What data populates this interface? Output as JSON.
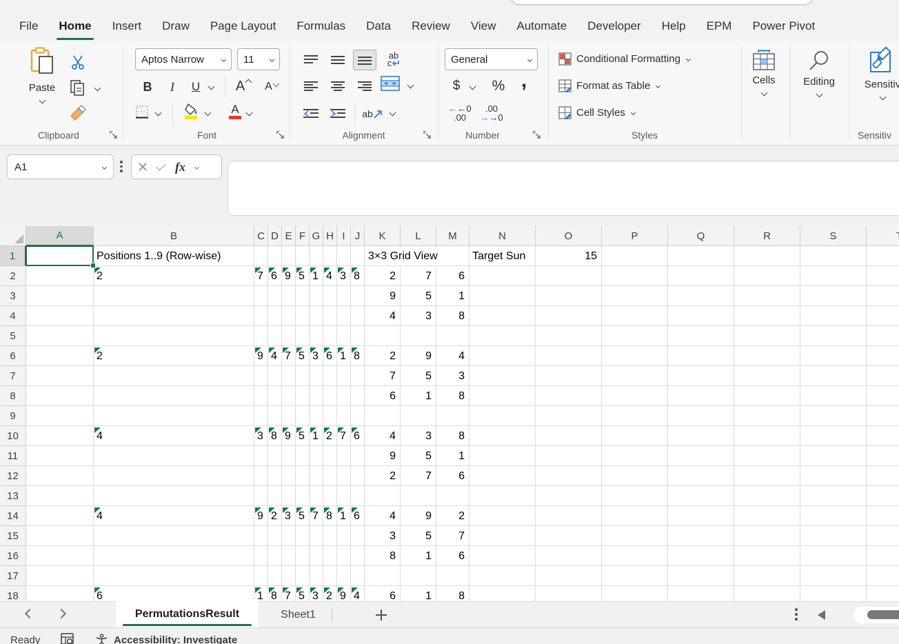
{
  "titlebar": {
    "menu": [
      "File",
      "Home",
      "Insert",
      "Draw",
      "Page Layout",
      "Formulas",
      "Data",
      "Review",
      "View",
      "Automate",
      "Developer",
      "Help",
      "EPM",
      "Power Pivot"
    ],
    "active_tab": "Home"
  },
  "colors": {
    "excel_green": "#217346",
    "selection_green": "#1E7145",
    "error_triangle_green": "#107C41",
    "accent_blue": "#2B7CD3",
    "fill_yellow": "#FFE400",
    "font_red": "#E03C31"
  },
  "ribbon": {
    "clipboard": {
      "group_label": "Clipboard",
      "paste_label": "Paste"
    },
    "font": {
      "group_label": "Font",
      "font_name": "Aptos Narrow",
      "font_size": "11",
      "bold": "B",
      "italic": "I",
      "underline": "U",
      "grow": "A",
      "shrink": "A"
    },
    "alignment": {
      "group_label": "Alignment",
      "wrap_top": "ab",
      "wrap_bottom": "c",
      "orient": "ab"
    },
    "number": {
      "group_label": "Number",
      "format": "General",
      "currency": "$",
      "percent": "%",
      "comma": ",",
      "inc_top": "←0",
      "inc_bot": ".00",
      "dec_top": ".00",
      "dec_bot": "→0"
    },
    "styles": {
      "group_label": "Styles",
      "items": [
        "Conditional Formatting",
        "Format as Table",
        "Cell Styles"
      ]
    },
    "cells": {
      "label": "Cells"
    },
    "editing": {
      "label": "Editing"
    },
    "sensitivity": {
      "label": "Sensitiv",
      "group_label": "Sensitiv"
    }
  },
  "formula_bar": {
    "name_box": "A1",
    "fx": "fx",
    "formula": ""
  },
  "grid": {
    "selected_cell": "A1",
    "columns": [
      "A",
      "B",
      "C",
      "D",
      "E",
      "F",
      "G",
      "H",
      "I",
      "J",
      "K",
      "L",
      "M",
      "N",
      "O",
      "P",
      "Q",
      "R",
      "S",
      "T"
    ],
    "row_numbers": [
      1,
      2,
      3,
      4,
      5,
      6,
      7,
      8,
      9,
      10,
      11,
      12,
      13,
      14,
      15,
      16,
      17,
      18
    ],
    "cells": [
      {
        "r": 1,
        "c": "B",
        "v": "Positions 1..9 (Row-wise)"
      },
      {
        "r": 1,
        "c": "K",
        "v": "3×3 Grid View",
        "span": 3
      },
      {
        "r": 1,
        "c": "N",
        "v": "Target Sun",
        "clip": true
      },
      {
        "r": 1,
        "c": "O",
        "v": "15",
        "a": "r"
      },
      {
        "r": 2,
        "c": "B",
        "v": "2",
        "t": 1
      },
      {
        "r": 2,
        "c": "C",
        "v": "7",
        "t": 1
      },
      {
        "r": 2,
        "c": "D",
        "v": "6",
        "t": 1
      },
      {
        "r": 2,
        "c": "E",
        "v": "9",
        "t": 1
      },
      {
        "r": 2,
        "c": "F",
        "v": "5",
        "t": 1
      },
      {
        "r": 2,
        "c": "G",
        "v": "1",
        "t": 1
      },
      {
        "r": 2,
        "c": "H",
        "v": "4",
        "t": 1
      },
      {
        "r": 2,
        "c": "I",
        "v": "3",
        "t": 1
      },
      {
        "r": 2,
        "c": "J",
        "v": "8",
        "t": 1
      },
      {
        "r": 2,
        "c": "K",
        "v": "2",
        "a": "r"
      },
      {
        "r": 2,
        "c": "L",
        "v": "7",
        "a": "r"
      },
      {
        "r": 2,
        "c": "M",
        "v": "6",
        "a": "r"
      },
      {
        "r": 3,
        "c": "K",
        "v": "9",
        "a": "r"
      },
      {
        "r": 3,
        "c": "L",
        "v": "5",
        "a": "r"
      },
      {
        "r": 3,
        "c": "M",
        "v": "1",
        "a": "r"
      },
      {
        "r": 4,
        "c": "K",
        "v": "4",
        "a": "r"
      },
      {
        "r": 4,
        "c": "L",
        "v": "3",
        "a": "r"
      },
      {
        "r": 4,
        "c": "M",
        "v": "8",
        "a": "r"
      },
      {
        "r": 6,
        "c": "B",
        "v": "2",
        "t": 1
      },
      {
        "r": 6,
        "c": "C",
        "v": "9",
        "t": 1
      },
      {
        "r": 6,
        "c": "D",
        "v": "4",
        "t": 1
      },
      {
        "r": 6,
        "c": "E",
        "v": "7",
        "t": 1
      },
      {
        "r": 6,
        "c": "F",
        "v": "5",
        "t": 1
      },
      {
        "r": 6,
        "c": "G",
        "v": "3",
        "t": 1
      },
      {
        "r": 6,
        "c": "H",
        "v": "6",
        "t": 1
      },
      {
        "r": 6,
        "c": "I",
        "v": "1",
        "t": 1
      },
      {
        "r": 6,
        "c": "J",
        "v": "8",
        "t": 1
      },
      {
        "r": 6,
        "c": "K",
        "v": "2",
        "a": "r"
      },
      {
        "r": 6,
        "c": "L",
        "v": "9",
        "a": "r"
      },
      {
        "r": 6,
        "c": "M",
        "v": "4",
        "a": "r"
      },
      {
        "r": 7,
        "c": "K",
        "v": "7",
        "a": "r"
      },
      {
        "r": 7,
        "c": "L",
        "v": "5",
        "a": "r"
      },
      {
        "r": 7,
        "c": "M",
        "v": "3",
        "a": "r"
      },
      {
        "r": 8,
        "c": "K",
        "v": "6",
        "a": "r"
      },
      {
        "r": 8,
        "c": "L",
        "v": "1",
        "a": "r"
      },
      {
        "r": 8,
        "c": "M",
        "v": "8",
        "a": "r"
      },
      {
        "r": 10,
        "c": "B",
        "v": "4",
        "t": 1
      },
      {
        "r": 10,
        "c": "C",
        "v": "3",
        "t": 1
      },
      {
        "r": 10,
        "c": "D",
        "v": "8",
        "t": 1
      },
      {
        "r": 10,
        "c": "E",
        "v": "9",
        "t": 1
      },
      {
        "r": 10,
        "c": "F",
        "v": "5",
        "t": 1
      },
      {
        "r": 10,
        "c": "G",
        "v": "1",
        "t": 1
      },
      {
        "r": 10,
        "c": "H",
        "v": "2",
        "t": 1
      },
      {
        "r": 10,
        "c": "I",
        "v": "7",
        "t": 1
      },
      {
        "r": 10,
        "c": "J",
        "v": "6",
        "t": 1
      },
      {
        "r": 10,
        "c": "K",
        "v": "4",
        "a": "r"
      },
      {
        "r": 10,
        "c": "L",
        "v": "3",
        "a": "r"
      },
      {
        "r": 10,
        "c": "M",
        "v": "8",
        "a": "r"
      },
      {
        "r": 11,
        "c": "K",
        "v": "9",
        "a": "r"
      },
      {
        "r": 11,
        "c": "L",
        "v": "5",
        "a": "r"
      },
      {
        "r": 11,
        "c": "M",
        "v": "1",
        "a": "r"
      },
      {
        "r": 12,
        "c": "K",
        "v": "2",
        "a": "r"
      },
      {
        "r": 12,
        "c": "L",
        "v": "7",
        "a": "r"
      },
      {
        "r": 12,
        "c": "M",
        "v": "6",
        "a": "r"
      },
      {
        "r": 14,
        "c": "B",
        "v": "4",
        "t": 1
      },
      {
        "r": 14,
        "c": "C",
        "v": "9",
        "t": 1
      },
      {
        "r": 14,
        "c": "D",
        "v": "2",
        "t": 1
      },
      {
        "r": 14,
        "c": "E",
        "v": "3",
        "t": 1
      },
      {
        "r": 14,
        "c": "F",
        "v": "5",
        "t": 1
      },
      {
        "r": 14,
        "c": "G",
        "v": "7",
        "t": 1
      },
      {
        "r": 14,
        "c": "H",
        "v": "8",
        "t": 1
      },
      {
        "r": 14,
        "c": "I",
        "v": "1",
        "t": 1
      },
      {
        "r": 14,
        "c": "J",
        "v": "6",
        "t": 1
      },
      {
        "r": 14,
        "c": "K",
        "v": "4",
        "a": "r"
      },
      {
        "r": 14,
        "c": "L",
        "v": "9",
        "a": "r"
      },
      {
        "r": 14,
        "c": "M",
        "v": "2",
        "a": "r"
      },
      {
        "r": 15,
        "c": "K",
        "v": "3",
        "a": "r"
      },
      {
        "r": 15,
        "c": "L",
        "v": "5",
        "a": "r"
      },
      {
        "r": 15,
        "c": "M",
        "v": "7",
        "a": "r"
      },
      {
        "r": 16,
        "c": "K",
        "v": "8",
        "a": "r"
      },
      {
        "r": 16,
        "c": "L",
        "v": "1",
        "a": "r"
      },
      {
        "r": 16,
        "c": "M",
        "v": "6",
        "a": "r"
      },
      {
        "r": 18,
        "c": "B",
        "v": "6",
        "t": 1
      },
      {
        "r": 18,
        "c": "C",
        "v": "1",
        "t": 1
      },
      {
        "r": 18,
        "c": "D",
        "v": "8",
        "t": 1
      },
      {
        "r": 18,
        "c": "E",
        "v": "7",
        "t": 1
      },
      {
        "r": 18,
        "c": "F",
        "v": "5",
        "t": 1
      },
      {
        "r": 18,
        "c": "G",
        "v": "3",
        "t": 1
      },
      {
        "r": 18,
        "c": "H",
        "v": "2",
        "t": 1
      },
      {
        "r": 18,
        "c": "I",
        "v": "9",
        "t": 1
      },
      {
        "r": 18,
        "c": "J",
        "v": "4",
        "t": 1
      },
      {
        "r": 18,
        "c": "K",
        "v": "6",
        "a": "r"
      },
      {
        "r": 18,
        "c": "L",
        "v": "1",
        "a": "r"
      },
      {
        "r": 18,
        "c": "M",
        "v": "8",
        "a": "r"
      }
    ]
  },
  "sheet_tabs": {
    "tabs": [
      {
        "label": "PermutationsResult",
        "active": true
      },
      {
        "label": "Sheet1",
        "active": false
      }
    ]
  },
  "status_bar": {
    "mode": "Ready",
    "accessibility": "Accessibility: Investigate"
  }
}
